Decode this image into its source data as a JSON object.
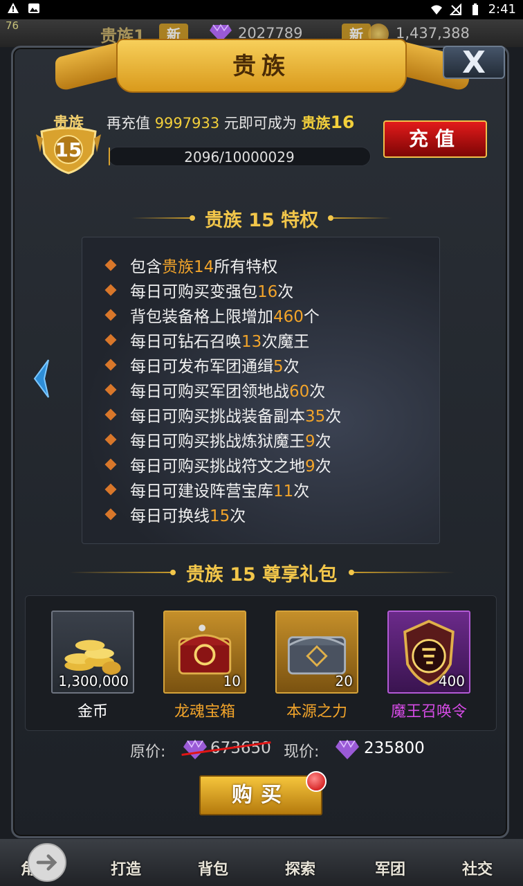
{
  "status_bar": {
    "time": "2:41",
    "left_icons": [
      "warning-icon",
      "image-icon"
    ],
    "right_icons": [
      "wifi-icon",
      "signal-off-icon",
      "battery-icon"
    ]
  },
  "hud": {
    "fps": "76",
    "noble_label": "贵族1",
    "new_badge": "新",
    "gems": "2027789",
    "new_badge_2": "新",
    "gold": "1,437,388"
  },
  "dialog": {
    "title": "贵族",
    "close_label": "X"
  },
  "noble": {
    "badge_label": "贵族",
    "level": "15",
    "recharge_prefix": "再充值 ",
    "recharge_amount": "9997933",
    "recharge_middle": " 元即可成为 ",
    "next_title": "贵族",
    "next_level": "16",
    "progress_text": "2096/10000029",
    "progress_fraction": 0.0002,
    "charge_button": "充值"
  },
  "privileges": {
    "title": "贵族 15 特权",
    "items": [
      {
        "pre": "包含",
        "hl": "贵族14",
        "post": "所有特权"
      },
      {
        "pre": "每日可购买变强包",
        "hl": "16",
        "post": "次"
      },
      {
        "pre": "背包装备格上限增加",
        "hl": "460",
        "post": "个"
      },
      {
        "pre": "每日可钻石召唤",
        "hl": "13",
        "post": "次魔王"
      },
      {
        "pre": "每日可发布军团通缉",
        "hl": "5",
        "post": "次"
      },
      {
        "pre": "每日可购买军团领地战",
        "hl": "60",
        "post": "次"
      },
      {
        "pre": "每日可购买挑战装备副本",
        "hl": "35",
        "post": "次"
      },
      {
        "pre": "每日可购买挑战炼狱魔王",
        "hl": "9",
        "post": "次"
      },
      {
        "pre": "每日可购买挑战符文之地",
        "hl": "9",
        "post": "次"
      },
      {
        "pre": "每日可建设阵营宝库",
        "hl": "11",
        "post": "次"
      },
      {
        "pre": "每日可换线",
        "hl": "15",
        "post": "次"
      }
    ]
  },
  "gift_pack": {
    "title": "贵族 15 尊享礼包",
    "items": [
      {
        "name": "金币",
        "qty": "1,300,000",
        "icon": "gold-coins-icon",
        "name_color": "#ffffff"
      },
      {
        "name": "龙魂宝箱",
        "qty": "10",
        "icon": "dragon-chest-icon",
        "name_color": "#f2a42a"
      },
      {
        "name": "本源之力",
        "qty": "20",
        "icon": "origin-chest-icon",
        "name_color": "#f2a42a"
      },
      {
        "name": "魔王召唤令",
        "qty": "400",
        "icon": "summon-token-icon",
        "name_color": "#d64be6"
      }
    ],
    "original_label": "原价:",
    "original_price": "673650",
    "current_label": "现价:",
    "current_price": "235800",
    "buy_button": "购买"
  },
  "bottom_nav": {
    "items": [
      "角",
      "打造",
      "背包",
      "探索",
      "军团",
      "社交"
    ]
  },
  "colors": {
    "gold_text": "#f2c64a",
    "highlight": "#f2a42a",
    "purple_text": "#d64be6",
    "charge_red": "#e21b1b"
  }
}
